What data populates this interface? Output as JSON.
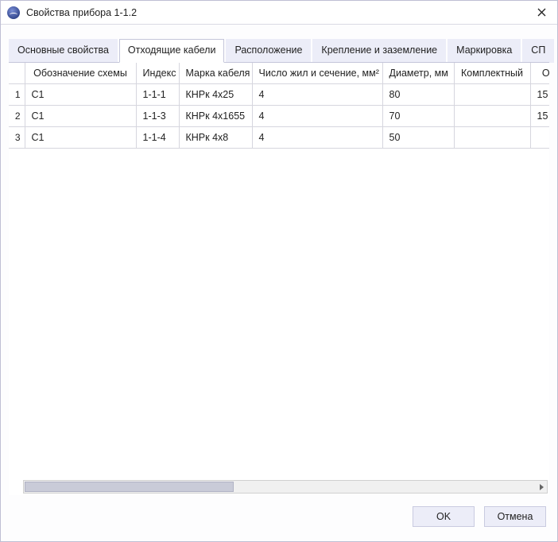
{
  "window": {
    "title": "Свойства прибора 1-1.2"
  },
  "tabs": [
    {
      "label": "Основные свойства"
    },
    {
      "label": "Отходящие кабели"
    },
    {
      "label": "Расположение"
    },
    {
      "label": "Крепление и заземление"
    },
    {
      "label": "Маркировка"
    },
    {
      "label": "СП"
    }
  ],
  "active_tab_index": 1,
  "columns": {
    "c0": "",
    "c1": "Обозначение схемы",
    "c2": "Индекс",
    "c3": "Марка кабеля",
    "c4": "Число жил и сечение, мм²",
    "c5": "Диаметр, мм",
    "c6": "Комплектный",
    "c7": "Огра"
  },
  "rows": [
    {
      "n": "1",
      "scheme": "C1",
      "index": "1-1-1",
      "brand": "КНРк 4х25",
      "cores": "4",
      "diameter": "80",
      "kit": "",
      "ogr": "15"
    },
    {
      "n": "2",
      "scheme": "C1",
      "index": "1-1-3",
      "brand": "КНРк 4х1655",
      "cores": "4",
      "diameter": "70",
      "kit": "",
      "ogr": "15"
    },
    {
      "n": "3",
      "scheme": "C1",
      "index": "1-1-4",
      "brand": "КНРк 4х8",
      "cores": "4",
      "diameter": "50",
      "kit": "",
      "ogr": ""
    }
  ],
  "buttons": {
    "ok": "OK",
    "cancel": "Отмена"
  }
}
